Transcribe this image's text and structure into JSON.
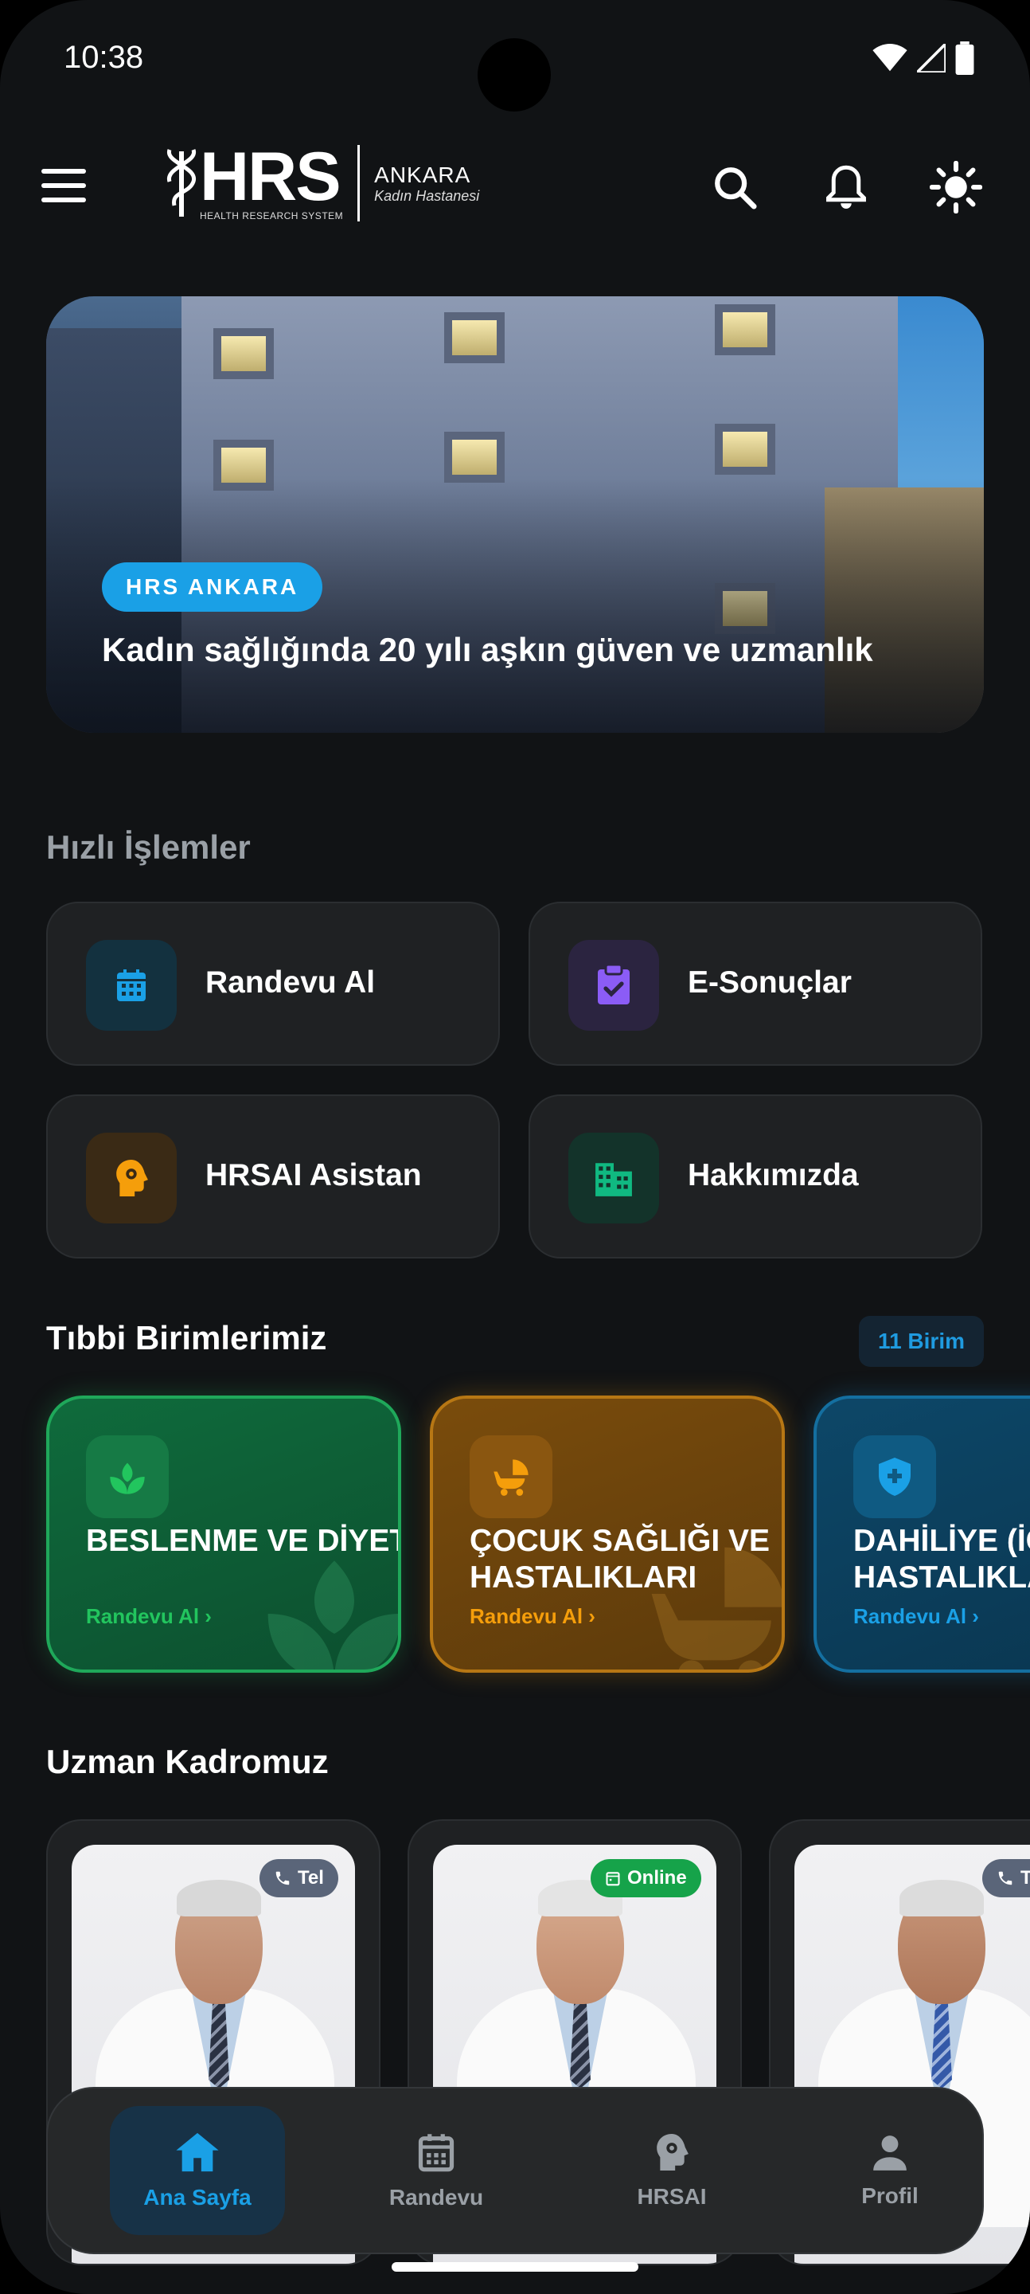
{
  "status_bar": {
    "time": "10:38"
  },
  "header": {
    "logo_text": "HRS",
    "logo_subtext": "HEALTH RESEARCH SYSTEM",
    "logo_city": "ANKARA",
    "logo_hospital": "Kadın Hastanesi"
  },
  "hero": {
    "badge": "HRS ANKARA",
    "tagline": "Kadın sağlığında 20 yılı aşkın güven ve uzmanlık"
  },
  "quick_actions": {
    "title": "Hızlı İşlemler",
    "items": [
      {
        "label": "Randevu Al",
        "icon": "calendar-icon",
        "color": "#1aa0e6"
      },
      {
        "label": "E-Sonuçlar",
        "icon": "clipboard-check-icon",
        "color": "#8b5cf6"
      },
      {
        "label": "HRSAI Asistan",
        "icon": "ai-head-icon",
        "color": "#f59e0b"
      },
      {
        "label": "Hakkımızda",
        "icon": "building-icon",
        "color": "#10b981"
      }
    ]
  },
  "units": {
    "title": "Tıbbi Birimlerimiz",
    "count_badge": "11 Birim",
    "items": [
      {
        "name": "BESLENME VE DİYET",
        "link": "Randevu Al",
        "icon": "sprout-icon",
        "color": "#22c55e"
      },
      {
        "name": "ÇOCUK SAĞLIĞI VE HASTALIKLARI",
        "link": "Randevu Al",
        "icon": "stroller-icon",
        "color": "#f59e0b"
      },
      {
        "name": "DAHİLİYE (İÇ HASTALIKLARI)",
        "link": "Randevu Al",
        "icon": "shield-plus-icon",
        "color": "#1aa0e6"
      }
    ]
  },
  "doctors": {
    "title": "Uzman Kadromuz",
    "items": [
      {
        "pill": "Tel",
        "pill_icon": "phone-icon"
      },
      {
        "pill": "Online",
        "pill_icon": "calendar-icon"
      },
      {
        "pill": "Tel",
        "pill_icon": "phone-icon"
      }
    ]
  },
  "bottom_nav": {
    "items": [
      {
        "label": "Ana Sayfa",
        "icon": "home-icon",
        "active": true
      },
      {
        "label": "Randevu",
        "icon": "calendar-icon",
        "active": false
      },
      {
        "label": "HRSAI",
        "icon": "ai-head-icon",
        "active": false
      },
      {
        "label": "Profil",
        "icon": "person-icon",
        "active": false
      }
    ]
  }
}
